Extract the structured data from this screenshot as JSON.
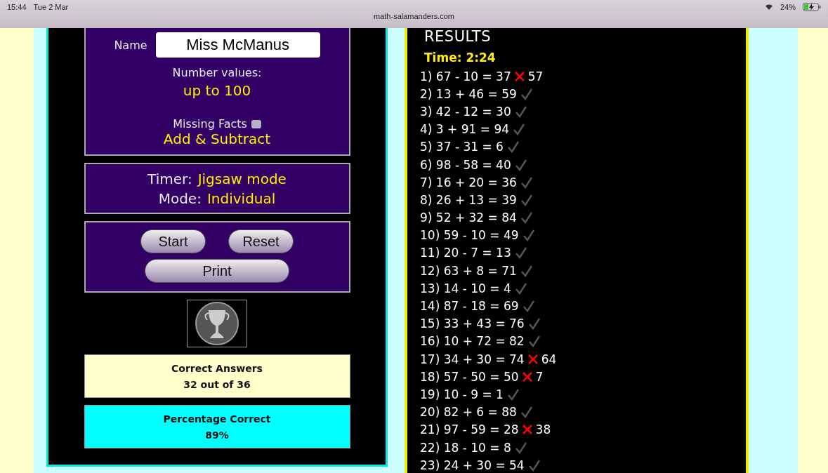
{
  "status_bar": {
    "time": "15:44",
    "date": "Tue 2 Mar",
    "url": "math-salamanders.com",
    "battery": "24%"
  },
  "settings": {
    "name_label": "Name",
    "name_value": "Miss McManus",
    "number_label": "Number values:",
    "number_value": "up to 100",
    "missing_facts_label": "Missing Facts",
    "missing_facts_checked": false,
    "operation": "Add & Subtract"
  },
  "mode_box": {
    "timer_label": "Timer:",
    "timer_value": "Jigsaw mode",
    "mode_label": "Mode:",
    "mode_value": "Individual"
  },
  "buttons": [
    {
      "label": "Start",
      "kind": "half"
    },
    {
      "label": "Reset",
      "kind": "half"
    },
    {
      "label": "Print",
      "kind": "wide"
    }
  ],
  "correct_answers": {
    "title": "Correct Answers",
    "value": "32 out of 36"
  },
  "percentage": {
    "title": "Percentage Correct",
    "value": "89%"
  },
  "results": {
    "title": "RESULTS",
    "time": "Time: 2:24",
    "rows": [
      {
        "text": "1) 67 - 10 = 37",
        "correct": false,
        "correction": "57"
      },
      {
        "text": "2) 13 + 46 = 59",
        "correct": true
      },
      {
        "text": "3) 42 - 12 = 30",
        "correct": true
      },
      {
        "text": "4) 3 + 91 = 94",
        "correct": true
      },
      {
        "text": "5) 37 - 31 = 6",
        "correct": true
      },
      {
        "text": "6) 98 - 58 = 40",
        "correct": true
      },
      {
        "text": "7) 16 + 20 = 36",
        "correct": true
      },
      {
        "text": "8) 26 + 13 = 39",
        "correct": true
      },
      {
        "text": "9) 52 + 32 = 84",
        "correct": true
      },
      {
        "text": "10) 59 - 10 = 49",
        "correct": true
      },
      {
        "text": "11) 20 - 7 = 13",
        "correct": true
      },
      {
        "text": "12) 63 + 8 = 71",
        "correct": true
      },
      {
        "text": "13) 14 - 10 = 4",
        "correct": true
      },
      {
        "text": "14) 87 - 18 = 69",
        "correct": true
      },
      {
        "text": "15) 33 + 43 = 76",
        "correct": true
      },
      {
        "text": "16) 10 + 72 = 82",
        "correct": true
      },
      {
        "text": "17) 34 + 30 = 74",
        "correct": false,
        "correction": "64"
      },
      {
        "text": "18) 57 - 50 = 50",
        "correct": false,
        "correction": "7"
      },
      {
        "text": "19) 10 - 9 = 1",
        "correct": true
      },
      {
        "text": "20) 82 + 6 = 88",
        "correct": true
      },
      {
        "text": "21) 97 - 59 = 28",
        "correct": false,
        "correction": "38"
      },
      {
        "text": "22) 18 - 10 = 8",
        "correct": true
      },
      {
        "text": "23) 24 + 30 = 54",
        "correct": true
      }
    ]
  }
}
